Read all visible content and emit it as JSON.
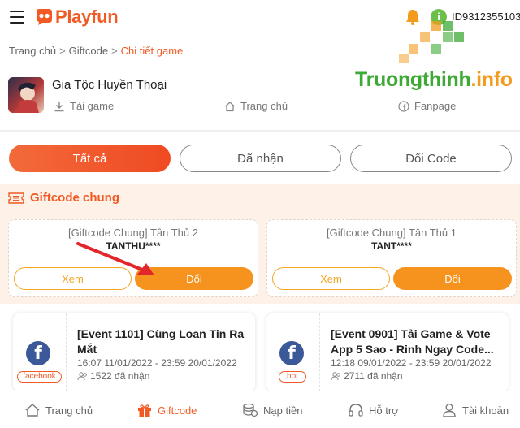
{
  "header": {
    "brand": "Playfun",
    "user_id": "ID9312355103",
    "info_badge": "i",
    "icons": [
      "menu-icon",
      "playfun-logo-icon",
      "bell-icon"
    ]
  },
  "watermark": {
    "text_main": "Truongthinh",
    "text_suffix": ".info"
  },
  "breadcrumb": {
    "home": "Trang chủ",
    "sep1": ">",
    "giftcode": "Giftcode",
    "sep2": ">",
    "current": "Chi tiết game"
  },
  "game": {
    "title": "Gia Tộc Huyền Thoại",
    "download_label": "Tải game",
    "home_label": "Trang chủ",
    "fanpage_label": "Fanpage"
  },
  "tabs": {
    "all": "Tất cả",
    "received": "Đã nhận",
    "exchange": "Đổi Code"
  },
  "section": {
    "title": "Giftcode chung"
  },
  "giftcodes": [
    {
      "name": "[Giftcode Chung] Tân Thủ 2",
      "code": "TANTHU****",
      "view_label": "Xem",
      "redeem_label": "Đổi"
    },
    {
      "name": "[Giftcode Chung] Tân Thủ 1",
      "code": "TANT****",
      "view_label": "Xem",
      "redeem_label": "Đổi"
    }
  ],
  "events": [
    {
      "title": "[Event 1101] Cùng Loan Tin Ra Mắt",
      "date": "16:07 11/01/2022 - 23:59 20/01/2022",
      "claimed": "1522 đã nhận",
      "tag": "facebook"
    },
    {
      "title": "[Event 0901] Tải Game & Vote App 5 Sao - Rinh Ngay Code...",
      "date": "12:18 09/01/2022 - 23:59 20/01/2022",
      "claimed": "2711 đã nhận",
      "tag": "hot"
    }
  ],
  "bottom_nav": {
    "home": "Trang chủ",
    "giftcode": "Giftcode",
    "topup": "Nạp tiền",
    "support": "Hỗ trợ",
    "account": "Tài khoản"
  },
  "colors": {
    "brand": "#f15a24",
    "accent": "#f5931e",
    "section_bg": "#fdf1e8",
    "facebook": "#3b5998",
    "watermark_green": "#3daa35"
  }
}
